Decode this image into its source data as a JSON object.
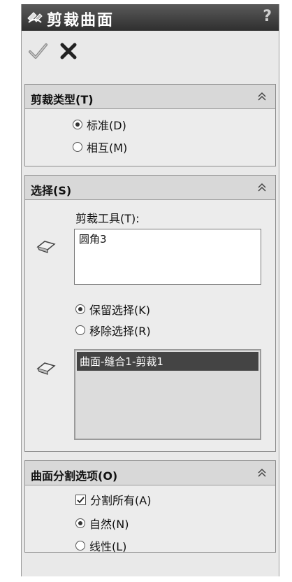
{
  "title": "剪裁曲面",
  "help": "?",
  "trim_type": {
    "title": "剪裁类型(T)",
    "options": [
      "标准(D)",
      "相互(M)"
    ],
    "selected": 0
  },
  "selection": {
    "title": "选择(S)",
    "tool_label": "剪裁工具(T):",
    "tool_item": "圆角3",
    "options": [
      "保留选择(K)",
      "移除选择(R)"
    ],
    "selected": 0,
    "surface_item": "曲面-缝合1-剪裁1"
  },
  "split": {
    "title": "曲面分割选项(O)",
    "split_all": "分割所有(A)",
    "split_all_checked": true,
    "options": [
      "自然(N)",
      "线性(L)"
    ],
    "selected": 0
  }
}
